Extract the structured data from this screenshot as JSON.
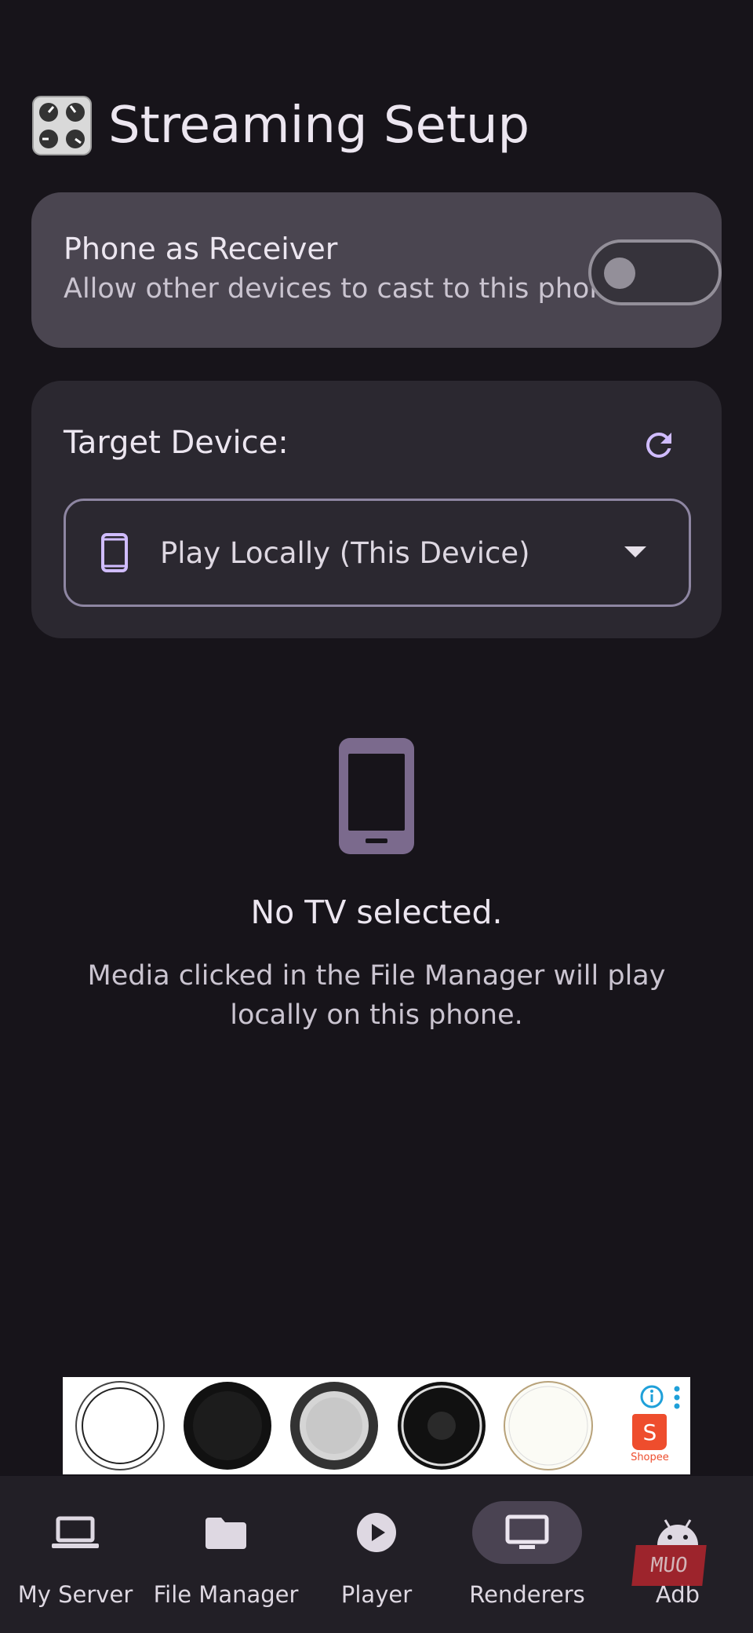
{
  "header": {
    "title": "Streaming Setup",
    "icon": "control-knobs-icon"
  },
  "receiver": {
    "title": "Phone as Receiver",
    "subtitle": "Allow other devices to cast to this phone",
    "enabled": false
  },
  "target": {
    "label": "Target Device:",
    "selected": "Play Locally (This Device)",
    "refresh_icon": "refresh-icon"
  },
  "empty_state": {
    "title": "No TV selected.",
    "description": "Media clicked in the File Manager will play locally on this phone."
  },
  "ad": {
    "brand": "Shopee",
    "shopee_glyph": "S"
  },
  "nav": {
    "items": [
      {
        "label": "My Server",
        "icon": "laptop-icon",
        "active": false
      },
      {
        "label": "File Manager",
        "icon": "folder-icon",
        "active": false
      },
      {
        "label": "Player",
        "icon": "play-icon",
        "active": false
      },
      {
        "label": "Renderers",
        "icon": "tv-icon",
        "active": true
      },
      {
        "label": "Adb",
        "icon": "android-icon",
        "active": false
      }
    ]
  },
  "watermark": "MUO",
  "colors": {
    "background": "#17141a",
    "accent": "#d0bcff",
    "card": "#4a4550",
    "card_dark": "#2b2830"
  }
}
